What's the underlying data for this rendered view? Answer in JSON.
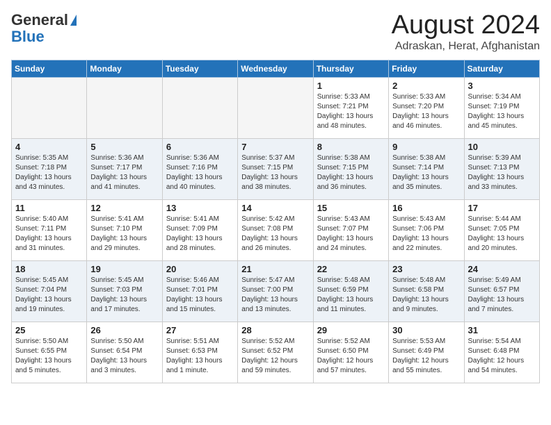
{
  "header": {
    "logo_general": "General",
    "logo_blue": "Blue",
    "title": "August 2024",
    "subtitle": "Adraskan, Herat, Afghanistan"
  },
  "days_of_week": [
    "Sunday",
    "Monday",
    "Tuesday",
    "Wednesday",
    "Thursday",
    "Friday",
    "Saturday"
  ],
  "weeks": [
    [
      {
        "day": "",
        "info": ""
      },
      {
        "day": "",
        "info": ""
      },
      {
        "day": "",
        "info": ""
      },
      {
        "day": "",
        "info": ""
      },
      {
        "day": "1",
        "info": "Sunrise: 5:33 AM\nSunset: 7:21 PM\nDaylight: 13 hours\nand 48 minutes."
      },
      {
        "day": "2",
        "info": "Sunrise: 5:33 AM\nSunset: 7:20 PM\nDaylight: 13 hours\nand 46 minutes."
      },
      {
        "day": "3",
        "info": "Sunrise: 5:34 AM\nSunset: 7:19 PM\nDaylight: 13 hours\nand 45 minutes."
      }
    ],
    [
      {
        "day": "4",
        "info": "Sunrise: 5:35 AM\nSunset: 7:18 PM\nDaylight: 13 hours\nand 43 minutes."
      },
      {
        "day": "5",
        "info": "Sunrise: 5:36 AM\nSunset: 7:17 PM\nDaylight: 13 hours\nand 41 minutes."
      },
      {
        "day": "6",
        "info": "Sunrise: 5:36 AM\nSunset: 7:16 PM\nDaylight: 13 hours\nand 40 minutes."
      },
      {
        "day": "7",
        "info": "Sunrise: 5:37 AM\nSunset: 7:15 PM\nDaylight: 13 hours\nand 38 minutes."
      },
      {
        "day": "8",
        "info": "Sunrise: 5:38 AM\nSunset: 7:15 PM\nDaylight: 13 hours\nand 36 minutes."
      },
      {
        "day": "9",
        "info": "Sunrise: 5:38 AM\nSunset: 7:14 PM\nDaylight: 13 hours\nand 35 minutes."
      },
      {
        "day": "10",
        "info": "Sunrise: 5:39 AM\nSunset: 7:13 PM\nDaylight: 13 hours\nand 33 minutes."
      }
    ],
    [
      {
        "day": "11",
        "info": "Sunrise: 5:40 AM\nSunset: 7:11 PM\nDaylight: 13 hours\nand 31 minutes."
      },
      {
        "day": "12",
        "info": "Sunrise: 5:41 AM\nSunset: 7:10 PM\nDaylight: 13 hours\nand 29 minutes."
      },
      {
        "day": "13",
        "info": "Sunrise: 5:41 AM\nSunset: 7:09 PM\nDaylight: 13 hours\nand 28 minutes."
      },
      {
        "day": "14",
        "info": "Sunrise: 5:42 AM\nSunset: 7:08 PM\nDaylight: 13 hours\nand 26 minutes."
      },
      {
        "day": "15",
        "info": "Sunrise: 5:43 AM\nSunset: 7:07 PM\nDaylight: 13 hours\nand 24 minutes."
      },
      {
        "day": "16",
        "info": "Sunrise: 5:43 AM\nSunset: 7:06 PM\nDaylight: 13 hours\nand 22 minutes."
      },
      {
        "day": "17",
        "info": "Sunrise: 5:44 AM\nSunset: 7:05 PM\nDaylight: 13 hours\nand 20 minutes."
      }
    ],
    [
      {
        "day": "18",
        "info": "Sunrise: 5:45 AM\nSunset: 7:04 PM\nDaylight: 13 hours\nand 19 minutes."
      },
      {
        "day": "19",
        "info": "Sunrise: 5:45 AM\nSunset: 7:03 PM\nDaylight: 13 hours\nand 17 minutes."
      },
      {
        "day": "20",
        "info": "Sunrise: 5:46 AM\nSunset: 7:01 PM\nDaylight: 13 hours\nand 15 minutes."
      },
      {
        "day": "21",
        "info": "Sunrise: 5:47 AM\nSunset: 7:00 PM\nDaylight: 13 hours\nand 13 minutes."
      },
      {
        "day": "22",
        "info": "Sunrise: 5:48 AM\nSunset: 6:59 PM\nDaylight: 13 hours\nand 11 minutes."
      },
      {
        "day": "23",
        "info": "Sunrise: 5:48 AM\nSunset: 6:58 PM\nDaylight: 13 hours\nand 9 minutes."
      },
      {
        "day": "24",
        "info": "Sunrise: 5:49 AM\nSunset: 6:57 PM\nDaylight: 13 hours\nand 7 minutes."
      }
    ],
    [
      {
        "day": "25",
        "info": "Sunrise: 5:50 AM\nSunset: 6:55 PM\nDaylight: 13 hours\nand 5 minutes."
      },
      {
        "day": "26",
        "info": "Sunrise: 5:50 AM\nSunset: 6:54 PM\nDaylight: 13 hours\nand 3 minutes."
      },
      {
        "day": "27",
        "info": "Sunrise: 5:51 AM\nSunset: 6:53 PM\nDaylight: 13 hours\nand 1 minute."
      },
      {
        "day": "28",
        "info": "Sunrise: 5:52 AM\nSunset: 6:52 PM\nDaylight: 12 hours\nand 59 minutes."
      },
      {
        "day": "29",
        "info": "Sunrise: 5:52 AM\nSunset: 6:50 PM\nDaylight: 12 hours\nand 57 minutes."
      },
      {
        "day": "30",
        "info": "Sunrise: 5:53 AM\nSunset: 6:49 PM\nDaylight: 12 hours\nand 55 minutes."
      },
      {
        "day": "31",
        "info": "Sunrise: 5:54 AM\nSunset: 6:48 PM\nDaylight: 12 hours\nand 54 minutes."
      }
    ]
  ]
}
